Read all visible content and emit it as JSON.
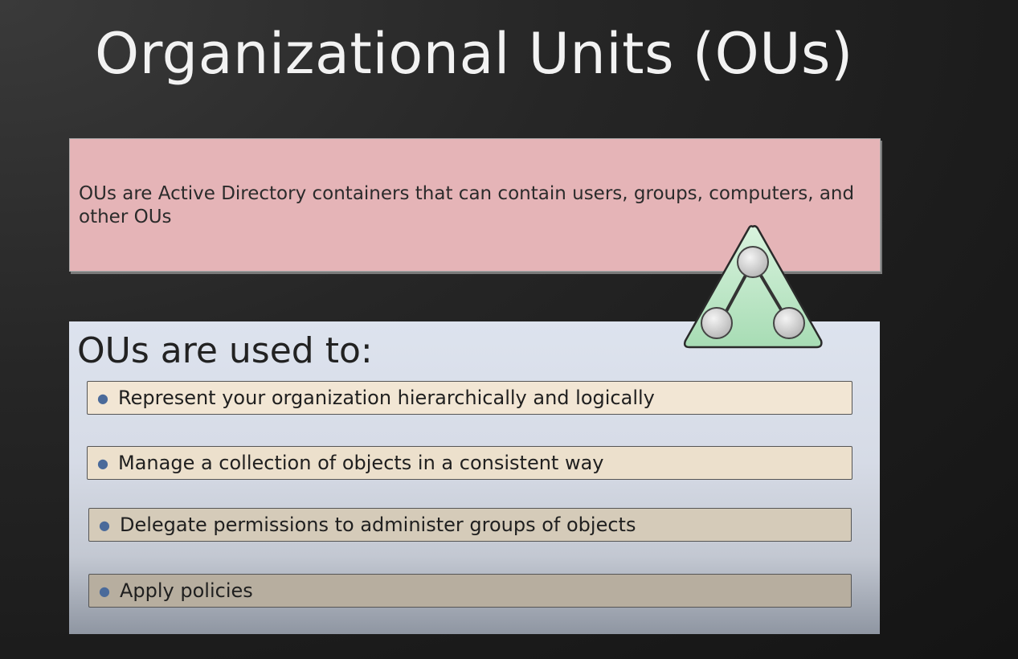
{
  "slide": {
    "title": "Organizational Units (OUs)",
    "definition": "OUs are Active Directory containers that can contain users, groups, computers, and other OUs",
    "uses_heading": "OUs are used to:",
    "uses": [
      "Represent your organization hierarchically and logically",
      "Manage a collection of objects in a consistent way",
      "Delegate permissions to administer groups of objects",
      "Apply policies"
    ],
    "icon": "ou-hierarchy-triangle-icon",
    "colors": {
      "definition_box": "#e5b4b7",
      "icon_fill": "#bfe8c8"
    }
  }
}
